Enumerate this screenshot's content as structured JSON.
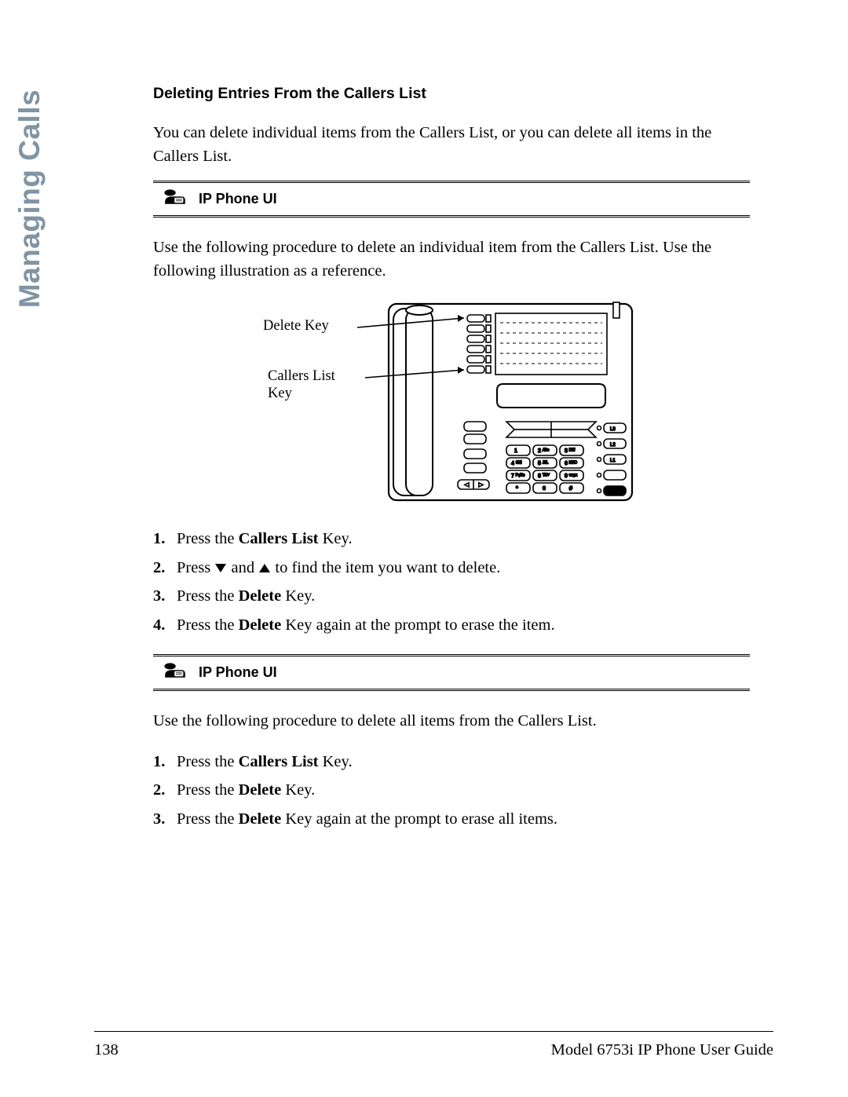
{
  "sidebar": {
    "title": "Managing Calls"
  },
  "content": {
    "heading": "Deleting Entries From the Callers List",
    "intro": "You can delete individual items from the Callers List, or you can delete all items in the Callers List.",
    "callout1": {
      "label": "IP Phone UI"
    },
    "para_after_callout1": "Use the following procedure to delete an individual item from the Callers List. Use the following illustration as a reference.",
    "figure": {
      "annot_delete": "Delete Key",
      "annot_callers1": "Callers List",
      "annot_callers2": "Key"
    },
    "steps1": [
      {
        "num": "1.",
        "pre": "Press the ",
        "bold": "Callers List",
        "post": " Key."
      },
      {
        "num": "2.",
        "pre": "Press ",
        "post": " to find the item you want to delete."
      },
      {
        "num": "3.",
        "pre": "Press the ",
        "bold": "Delete",
        "post": " Key."
      },
      {
        "num": "4.",
        "pre": "Press the ",
        "bold": "Delete",
        "post": " Key again at the prompt to erase the item."
      }
    ],
    "callout2": {
      "label": "IP Phone UI"
    },
    "para_after_callout2": "Use the following procedure to delete all items from the Callers List.",
    "steps2": [
      {
        "num": "1.",
        "pre": "Press the ",
        "bold": "Callers List",
        "post": " Key."
      },
      {
        "num": "2.",
        "pre": "Press the ",
        "bold": "Delete",
        "post": " Key."
      },
      {
        "num": "3.",
        "pre": "Press the ",
        "bold": "Delete",
        "post": " Key again at the prompt to erase all items."
      }
    ]
  },
  "footer": {
    "page_number": "138",
    "doc_title": "Model 6753i IP Phone User Guide"
  },
  "steps_and": " and "
}
